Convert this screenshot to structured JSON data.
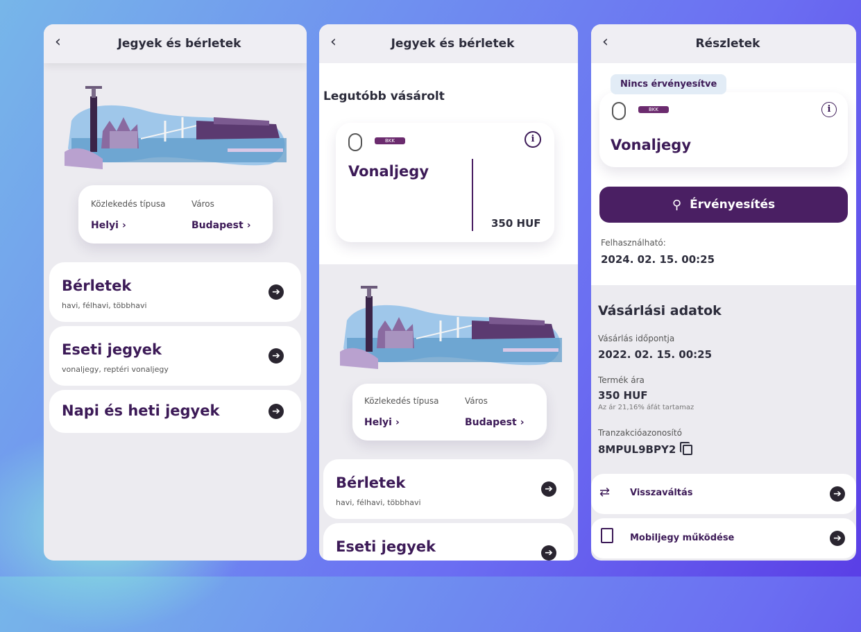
{
  "panel1": {
    "title": "Jegyek és bérletek",
    "transport_type_label": "Közlekedés típusa",
    "transport_type_value": "Helyi",
    "city_label": "Város",
    "city_value": "Budapest",
    "items": [
      {
        "title": "Bérletek",
        "subtitle": "havi, félhavi, többhavi"
      },
      {
        "title": "Eseti jegyek",
        "subtitle": "vonaljegy, reptéri vonaljegy"
      },
      {
        "title": "Napi és heti jegyek",
        "subtitle": ""
      }
    ]
  },
  "panel2": {
    "title": "Jegyek és bérletek",
    "recent_heading": "Legutóbb vásárolt",
    "ticket_name": "Vonaljegy",
    "ticket_price": "350 HUF",
    "transport_type_label": "Közlekedés típusa",
    "transport_type_value": "Helyi",
    "city_label": "Város",
    "city_value": "Budapest",
    "items": [
      {
        "title": "Bérletek",
        "subtitle": "havi, félhavi, többhavi"
      },
      {
        "title": "Eseti jegyek",
        "subtitle": ""
      }
    ]
  },
  "panel3": {
    "title": "Részletek",
    "status_badge": "Nincs érvényesítve",
    "ticket_name": "Vonaljegy",
    "validate_button": "Érvényesítés",
    "usable_label": "Felhasználható:",
    "usable_value": "2024. 02. 15. 00:25",
    "purchase_heading": "Vásárlási adatok",
    "purchase_time_label": "Vásárlás időpontja",
    "purchase_time_value": "2022. 02. 15. 00:25",
    "price_label": "Termék ára",
    "price_value": "350 HUF",
    "price_note": "Az ár 21,16% áfát tartamaz",
    "transaction_label": "Tranzakcióazonosító",
    "transaction_value": "8MPUL9BPY2",
    "refund_label": "Visszaváltás",
    "mobile_ticket_label": "Mobiljegy működése"
  },
  "icons": {
    "back": "chevron-left-icon",
    "arrow": "arrow-right-circle-icon",
    "info": "info-icon",
    "copy": "copy-icon",
    "exchange": "exchange-icon",
    "phone": "phone-icon"
  },
  "colors": {
    "accent": "#4a1f63",
    "text_dark": "#3c1a57"
  }
}
